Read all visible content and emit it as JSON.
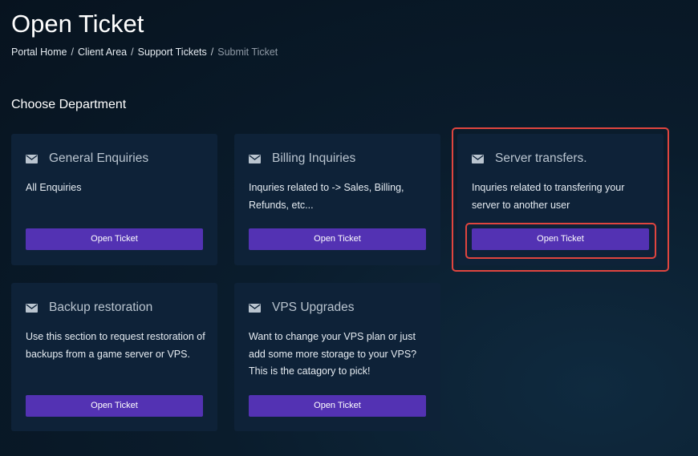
{
  "page": {
    "title": "Open Ticket"
  },
  "breadcrumb": {
    "items": [
      {
        "label": "Portal Home"
      },
      {
        "label": "Client Area"
      },
      {
        "label": "Support Tickets"
      }
    ],
    "current": "Submit Ticket",
    "separator": "/"
  },
  "section": {
    "heading": "Choose Department"
  },
  "departments": [
    {
      "icon": "envelope-icon",
      "title": "General Enquiries",
      "description": "All Enquiries",
      "button_label": "Open Ticket"
    },
    {
      "icon": "envelope-icon",
      "title": "Billing Inquiries",
      "description": "Inquries related to -> Sales, Billing, Refunds, etc...",
      "button_label": "Open Ticket"
    },
    {
      "icon": "envelope-icon",
      "title": "Server transfers.",
      "description": "Inquries related to transfering your server to another user",
      "button_label": "Open Ticket",
      "highlighted": true
    },
    {
      "icon": "envelope-icon",
      "title": "Backup restoration",
      "description": "Use this section to request restoration of backups from a game server or VPS.",
      "button_label": "Open Ticket"
    },
    {
      "icon": "envelope-icon",
      "title": "VPS Upgrades",
      "description": "Want to change your VPS plan or just add some more storage to your VPS? This is the catagory to pick!",
      "button_label": "Open Ticket"
    }
  ],
  "colors": {
    "background": "#0a1c2c",
    "card": "#0e2238",
    "button": "#5332b3",
    "highlight": "#e0453f",
    "card_title": "#b9c4cf"
  }
}
